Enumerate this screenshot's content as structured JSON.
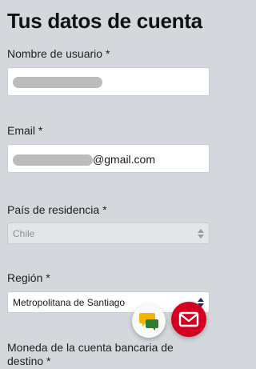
{
  "title": "Tus datos de cuenta",
  "fields": {
    "username": {
      "label": "Nombre de usuario *"
    },
    "email": {
      "label": "Email *",
      "visible_suffix": "@gmail.com"
    },
    "country": {
      "label": "País de residencia *",
      "value": "Chile",
      "disabled": true
    },
    "region": {
      "label": "Región *",
      "value": "Metropolitana de Santiago"
    },
    "currency": {
      "label_line1": "Moneda de la cuenta bancaria de",
      "label_line2": "destino *"
    }
  },
  "colors": {
    "background": "#d4d7db",
    "mail_button": "#d3001f",
    "chat_bubble_yellow": "#f4b400",
    "chat_bubble_green": "#2e7d32"
  },
  "icons": {
    "chat": "chat-bubbles-icon",
    "mail": "envelope-icon",
    "select": "up-down-arrows-icon"
  }
}
